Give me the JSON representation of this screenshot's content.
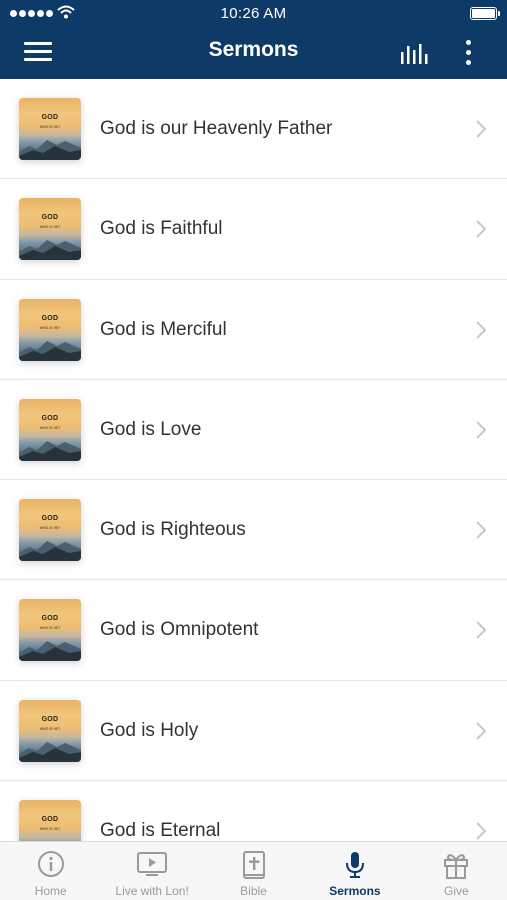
{
  "status_bar": {
    "time": "10:26 AM"
  },
  "header": {
    "title": "Sermons"
  },
  "thumbnail": {
    "title": "GOD",
    "subtitle": "WHO IS HE?"
  },
  "sermons": [
    {
      "title": "God is our Heavenly Father"
    },
    {
      "title": "God is Faithful"
    },
    {
      "title": "God is Merciful"
    },
    {
      "title": "God is Love"
    },
    {
      "title": "God is Righteous"
    },
    {
      "title": "God is Omnipotent"
    },
    {
      "title": "God is Holy"
    },
    {
      "title": "God is Eternal"
    }
  ],
  "tabs": [
    {
      "label": "Home",
      "icon": "info-icon"
    },
    {
      "label": "Live with Lon!",
      "icon": "tv-icon"
    },
    {
      "label": "Bible",
      "icon": "bible-icon"
    },
    {
      "label": "Sermons",
      "icon": "microphone-icon",
      "active": true
    },
    {
      "label": "Give",
      "icon": "gift-icon"
    }
  ],
  "colors": {
    "header_bg": "#0d3a66",
    "active_tab": "#0d3a66",
    "inactive_tab": "#9a9a9a"
  }
}
